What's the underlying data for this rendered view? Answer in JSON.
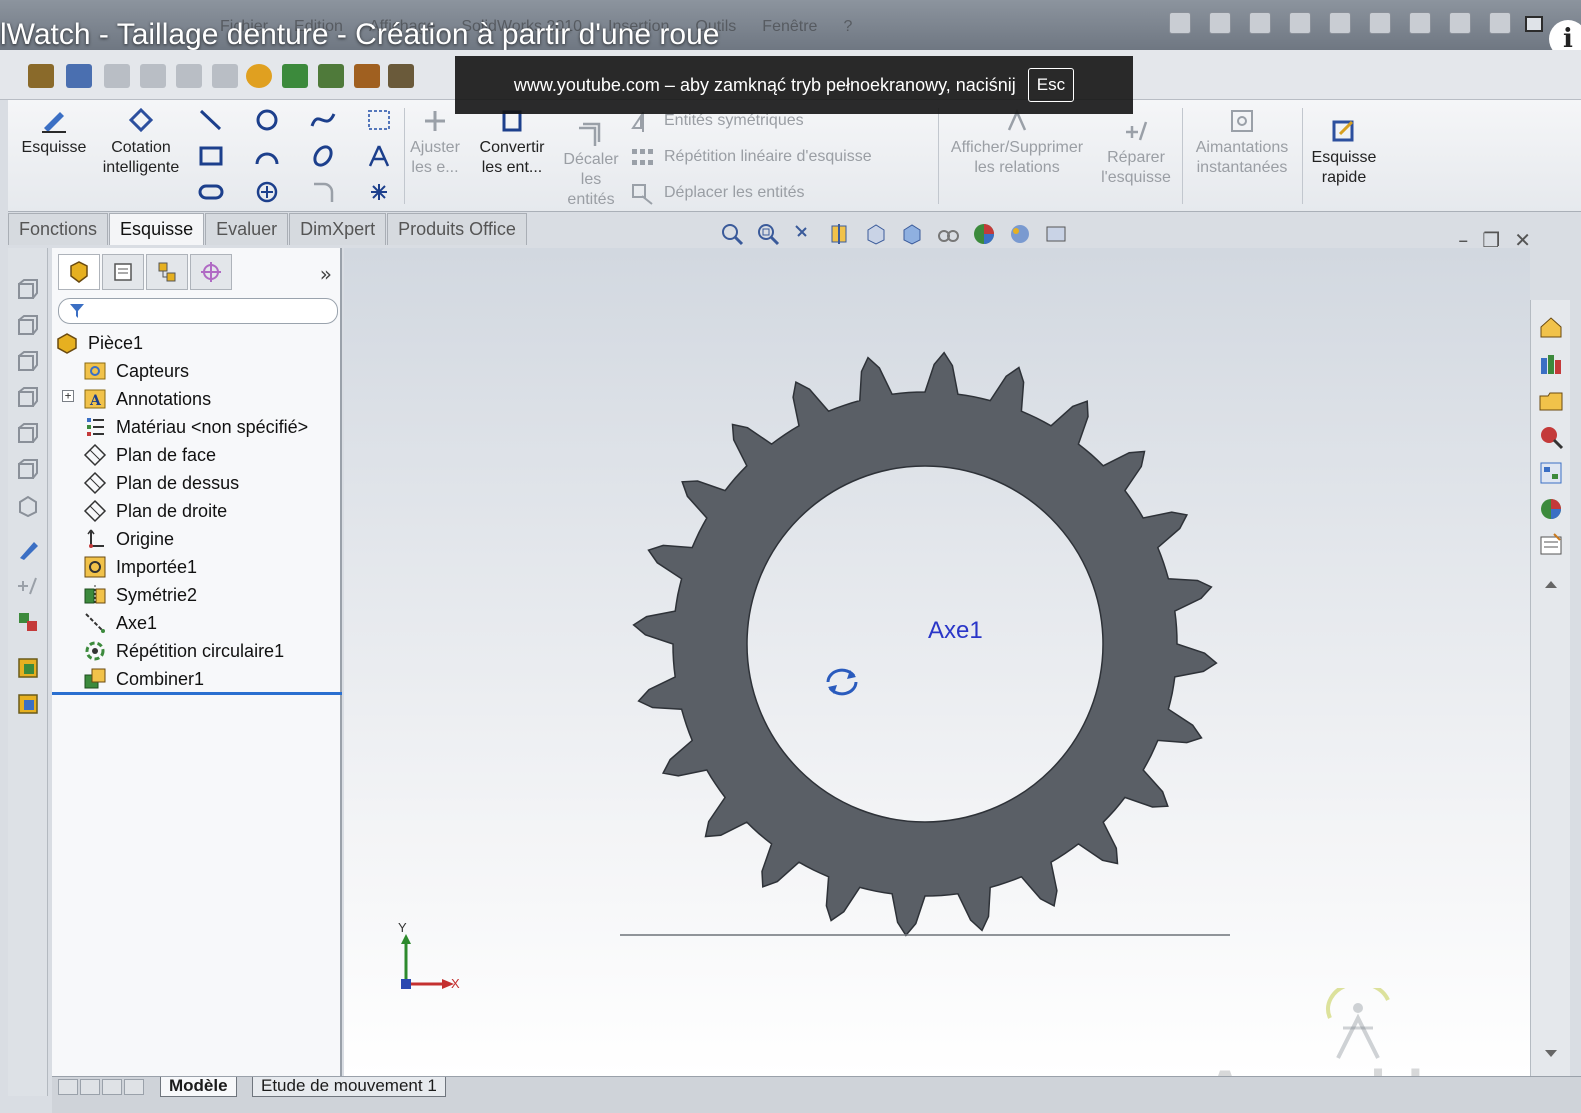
{
  "window": {
    "video_title": "lWatch - Taillage denture - Création à partir d'une roue",
    "ghost_menu": [
      "Fichier",
      "Edition",
      "Affichage",
      "SolidWorks 2010",
      "Insertion",
      "Outils",
      "Fenêtre",
      "?"
    ]
  },
  "youtube_overlay": {
    "message": "www.youtube.com – aby zamknąć tryb pełnoekranowy, naciśnij",
    "key": "Esc"
  },
  "ribbon": {
    "esquisse": "Esquisse",
    "cotation_l1": "Cotation",
    "cotation_l2": "intelligente",
    "ajuster_l1": "Ajuster",
    "ajuster_l2": "les e...",
    "convertir_l1": "Convertir",
    "convertir_l2": "les ent...",
    "decaler_l1": "Décaler",
    "decaler_l2": "les",
    "decaler_l3": "entités",
    "entites_symetriques": "Entités symétriques",
    "repetition_lineaire": "Répétition linéaire d'esquisse",
    "deplacer_entites": "Déplacer les entités",
    "afficher_l1": "Afficher/Supprimer",
    "afficher_l2": "les relations",
    "reparer_l1": "Réparer",
    "reparer_l2": "l'esquisse",
    "aimantations_l1": "Aimantations",
    "aimantations_l2": "instantanées",
    "esquisse_rapide_l1": "Esquisse",
    "esquisse_rapide_l2": "rapide"
  },
  "tabs": [
    "Fonctions",
    "Esquisse",
    "Evaluer",
    "DimXpert",
    "Produits Office"
  ],
  "feature_tree": {
    "root": "Pièce1",
    "items": [
      "Capteurs",
      "Annotations",
      "Matériau <non spécifié>",
      "Plan de face",
      "Plan de dessus",
      "Plan de droite",
      "Origine",
      "Importée1",
      "Symétrie2",
      "Axe1",
      "Répétition circulaire1",
      "Combiner1"
    ],
    "more": "»"
  },
  "viewport": {
    "axis_label": "Axe1",
    "triad_x": "X",
    "triad_y": "Y",
    "watermark": "Axemble",
    "gear_teeth": 24,
    "colors": {
      "gear": "#5a5f66",
      "axis": "#2a36c8",
      "bore": "#ffffff"
    }
  },
  "bottom_tabs": [
    "Modèle",
    "Etude de mouvement 1"
  ]
}
